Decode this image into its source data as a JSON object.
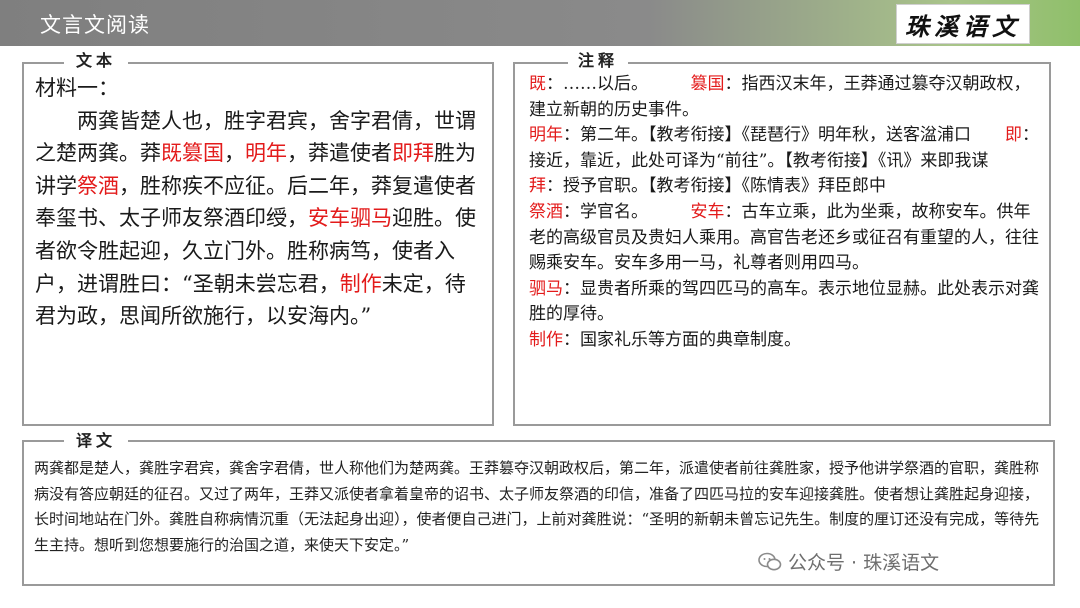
{
  "header": {
    "title": "文言文阅读",
    "logo_text": "珠溪语文"
  },
  "tags": {
    "source": "文本",
    "notes": "注释",
    "translation": "译文"
  },
  "source": {
    "heading": "材料一：",
    "p1": "两龚皆楚人也，胜字君宾，舍字君倩，世谓之楚两龚。莽",
    "r1": "既篡国",
    "p2": "，",
    "r2": "明年",
    "p3": "，莽遣使者",
    "r3": "即拜",
    "p4": "胜为讲学",
    "r4": "祭酒",
    "p5": "，胜称疾不应征。后二年，莽复遣使者奉玺书、太子师友祭酒印绶，",
    "r5": "安车驷马",
    "p6": "迎胜。使者欲令胜起迎，久立门外。胜称病笃，使者入户，进谓胜曰：“圣朝未尝忘君，",
    "r6": "制作",
    "p7": "未定，待君为政，思闻所欲施行，以安海内。”"
  },
  "notes": [
    {
      "term": "既",
      "text": "：……以后。",
      "gap": "　　　",
      "term2": "篡国",
      "text2": "：指西汉末年，王莽通过篡夺汉朝政权，建立新朝的历史事件。"
    },
    {
      "term": "明年",
      "text": "：第二年。【教考衔接】《琵琶行》明年秋，送客湓浦口",
      "gap": "　　",
      "term2": "即",
      "text2": "：接近，靠近，此处可译为“前往”。【教考衔接】《讯》来即我谋"
    },
    {
      "term": "拜",
      "text": "：授予官职。【教考衔接】《陈情表》拜臣郎中"
    },
    {
      "term": "祭酒",
      "text": "：学官名。",
      "gap": "　　　",
      "term2": "安车",
      "text2": "：古车立乘，此为坐乘，故称安车。供年老的高级官员及贵妇人乘用。高官告老还乡或征召有重望的人，往往赐乘安车。安车多用一马，礼尊者则用四马。"
    },
    {
      "term": "驷马",
      "text": "：显贵者所乘的驾四匹马的高车。表示地位显赫。此处表示对龚胜的厚待。"
    },
    {
      "term": "制作",
      "text": "：国家礼乐等方面的典章制度。"
    }
  ],
  "translation": "两龚都是楚人，龚胜字君宾，龚舍字君倩，世人称他们为楚两龚。王莽篡夺汉朝政权后，第二年，派遣使者前往龚胜家，授予他讲学祭酒的官职，龚胜称病没有答应朝廷的征召。又过了两年，王莽又派使者拿着皇帝的诏书、太子师友祭酒的印信，准备了四匹马拉的安车迎接龚胜。使者想让龚胜起身迎接，长时间地站在门外。龚胜自称病情沉重（无法起身出迎），使者便自己进门，上前对龚胜说：“圣明的新朝未曾忘记先生。制度的厘订还没有完成，等待先生主持。想听到您想要施行的治国之道，来使天下安定。”",
  "watermark": "公众号 · 珠溪语文",
  "colors": {
    "highlight": "#e31b1b",
    "panel_border": "#9a9a9a",
    "topbar": "#7f7f7f",
    "accent": "#8fbf6a"
  }
}
